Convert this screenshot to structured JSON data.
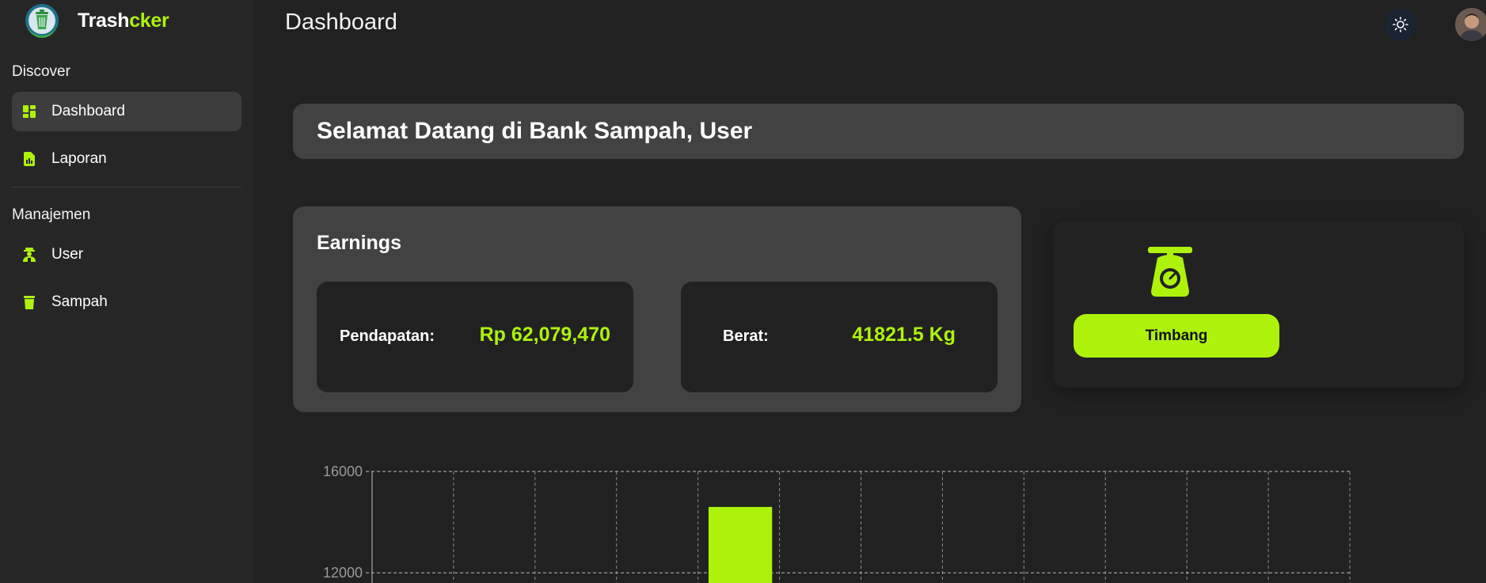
{
  "brand": {
    "name_part1": "Trash",
    "name_part2": "cker",
    "logo_icon": "trash-bin-logo-icon"
  },
  "sidebar": {
    "sections": [
      {
        "title": "Discover",
        "items": [
          {
            "label": "Dashboard",
            "icon": "dashboard-grid-icon",
            "active": true
          },
          {
            "label": "Laporan",
            "icon": "report-file-icon",
            "active": false
          }
        ]
      },
      {
        "title": "Manajemen",
        "items": [
          {
            "label": "User",
            "icon": "users-icon",
            "active": false
          },
          {
            "label": "Sampah",
            "icon": "trash-icon",
            "active": false
          }
        ]
      }
    ]
  },
  "header": {
    "title": "Dashboard",
    "theme_icon": "sun-icon",
    "avatar_icon": "user-avatar"
  },
  "welcome": {
    "text": "Selamat Datang di Bank Sampah, User"
  },
  "earnings": {
    "title": "Earnings",
    "pendapatan": {
      "label": "Pendapatan:",
      "value": "Rp 62,079,470"
    },
    "berat": {
      "label": "Berat:",
      "value": "41821.5 Kg"
    }
  },
  "scale": {
    "icon": "weighing-scale-icon",
    "button_label": "Timbang"
  },
  "colors": {
    "accent": "#aef20c",
    "background": "#212121",
    "sidebar": "#262626",
    "card": "#424242"
  },
  "chart_data": {
    "type": "bar",
    "y_ticks": [
      16000,
      12000
    ],
    "ylim_visible": [
      11600,
      16000
    ],
    "grid": true,
    "series": [
      {
        "values": [
          null,
          null,
          null,
          null,
          14600,
          null,
          null,
          null,
          null,
          null,
          null,
          null
        ]
      }
    ]
  }
}
